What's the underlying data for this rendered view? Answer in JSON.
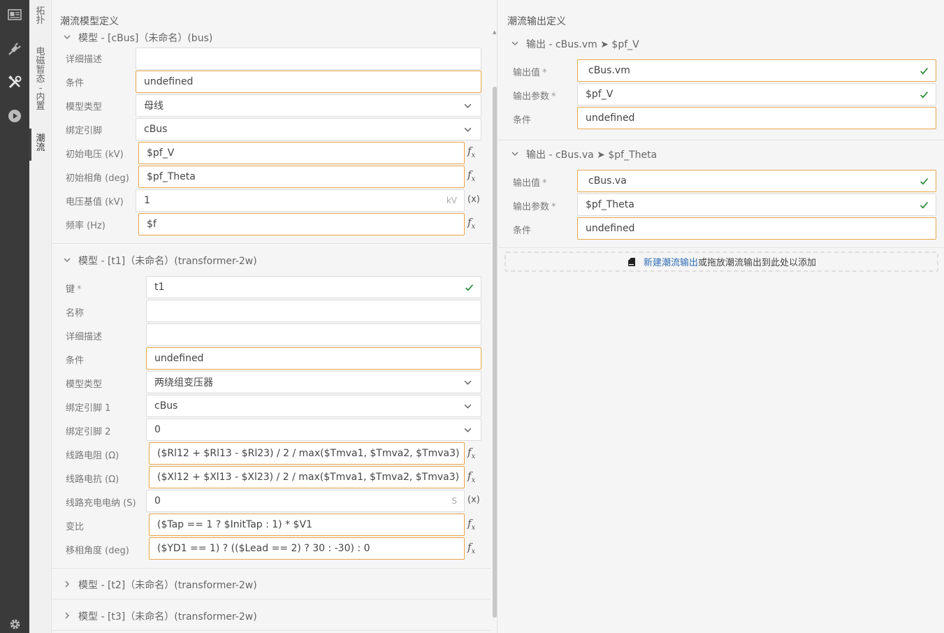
{
  "activity_bar": {
    "items": [
      {
        "name": "layout-icon"
      },
      {
        "name": "plug-icon"
      },
      {
        "name": "tools-icon"
      },
      {
        "name": "play-icon"
      }
    ],
    "settings": {
      "name": "gear-icon"
    }
  },
  "vertical_tabs": [
    {
      "label": "拓扑",
      "chars": [
        "拓",
        "扑"
      ]
    },
    {
      "label": "电磁暂态 - 内置",
      "chars": [
        "电",
        "磁",
        "暂",
        "态",
        "-",
        "内",
        "置"
      ]
    },
    {
      "label": "潮流",
      "chars": [
        "潮",
        "流"
      ]
    }
  ],
  "left_panel": {
    "title": "潮流模型定义",
    "model_bus": {
      "header": "模型 - [cBus]（未命名）(bus)",
      "rows": [
        {
          "label": "详细描述",
          "value": "",
          "kind": "text"
        },
        {
          "label": "条件",
          "value": "undefined",
          "kind": "text"
        },
        {
          "label": "模型类型",
          "value": "母线",
          "kind": "select"
        },
        {
          "label": "绑定引脚",
          "value": "cBus",
          "kind": "select"
        },
        {
          "label": "初始电压 (kV)",
          "value": "$pf_V",
          "kind": "fx"
        },
        {
          "label": "初始相角 (deg)",
          "value": "$pf_Theta",
          "kind": "fx"
        },
        {
          "label": "电压基值 (kV)",
          "value": "1",
          "kind": "unit",
          "unit": "kV",
          "extra": "(x)"
        },
        {
          "label": "频率 (Hz)",
          "value": "$f",
          "kind": "fx"
        }
      ]
    },
    "model_t1": {
      "header": "模型 - [t1]（未命名）(transformer-2w)",
      "rows": [
        {
          "label": "键",
          "required": "*",
          "value": "t1",
          "kind": "check"
        },
        {
          "label": "名称",
          "value": "",
          "kind": "text"
        },
        {
          "label": "详细描述",
          "value": "",
          "kind": "text"
        },
        {
          "label": "条件",
          "value": "undefined",
          "kind": "text"
        },
        {
          "label": "模型类型",
          "value": "两绕组变压器",
          "kind": "select"
        },
        {
          "label": "绑定引脚 1",
          "value": "cBus",
          "kind": "select"
        },
        {
          "label": "绑定引脚 2",
          "value": "0",
          "kind": "select"
        },
        {
          "label": "线路电阻 (Ω)",
          "value": "($Rl12 + $Rl13 - $Rl23) / 2 / max($Tmva1, $Tmva2, $Tmva3)",
          "kind": "fx"
        },
        {
          "label": "线路电抗 (Ω)",
          "value": "($Xl12 + $Xl13 - $Xl23) / 2 / max($Tmva1, $Tmva2, $Tmva3)",
          "kind": "fx"
        },
        {
          "label": "线路充电电纳 (S)",
          "value": "0",
          "kind": "unit",
          "unit": "S",
          "extra": "(x)"
        },
        {
          "label": "变比",
          "value": "($Tap == 1 ? $InitTap : 1) * $V1",
          "kind": "fx"
        },
        {
          "label": "移相角度 (deg)",
          "value": "($YD1 == 1) ? (($Lead == 2) ? 30 : -30) : 0",
          "kind": "fx"
        }
      ]
    },
    "model_t2": {
      "header": "模型 - [t2]（未命名）(transformer-2w)"
    },
    "model_t3": {
      "header": "模型 - [t3]（未命名）(transformer-2w)"
    },
    "fx_label": "f",
    "fx_sub": "x"
  },
  "right_panel": {
    "title": "潮流输出定义",
    "outputs": [
      {
        "header": "输出 - cBus.vm ➤ $pf_V",
        "rows": [
          {
            "label": "输出值",
            "required": "*",
            "value": "cBus.vm",
            "check": true
          },
          {
            "label": "输出参数",
            "required": "*",
            "value": "$pf_V",
            "check": true
          },
          {
            "label": "条件",
            "value": "undefined",
            "check": false
          }
        ]
      },
      {
        "header": "输出 - cBus.va ➤ $pf_Theta",
        "rows": [
          {
            "label": "输出值",
            "required": "*",
            "value": "cBus.va",
            "check": true
          },
          {
            "label": "输出参数",
            "required": "*",
            "value": "$pf_Theta",
            "check": true
          },
          {
            "label": "条件",
            "value": "undefined",
            "check": false
          }
        ]
      }
    ],
    "dropzone": {
      "link": "新建潮流输出",
      "text": "或拖放潮流输出到此处以添加"
    }
  },
  "colors": {
    "accent_orange": "#e8a64a",
    "check_green": "#2e8b3a",
    "link_blue": "#2f6db5",
    "activity_bg": "#3a3a3a"
  }
}
